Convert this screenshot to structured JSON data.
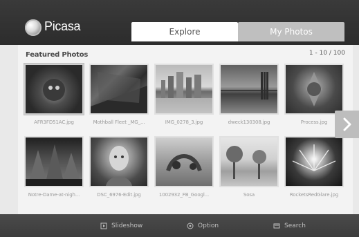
{
  "app": {
    "title": "Picasa",
    "tabs": [
      {
        "label": "Explore",
        "active": true
      },
      {
        "label": "My Photos",
        "active": false
      }
    ]
  },
  "main": {
    "section_title": "Featured Photos",
    "counter": "1 - 10 / 100",
    "photos": [
      {
        "filename": "AFR3FD51AC.jpg"
      },
      {
        "filename": "Mothball Fleet _MG_..."
      },
      {
        "filename": "IMG_0278_3.jpg"
      },
      {
        "filename": "dweck130308.jpg"
      },
      {
        "filename": "Process.jpg"
      },
      {
        "filename": "Notre-Dame-at-nigh..."
      },
      {
        "filename": "DSC_6976-Edit.jpg"
      },
      {
        "filename": "1002932_FB_Googl..."
      },
      {
        "filename": "Sosa"
      },
      {
        "filename": "RocketsRedGlare.jpg"
      }
    ]
  },
  "footer": {
    "items": [
      {
        "label": "Slideshow",
        "icon": "slideshow-icon"
      },
      {
        "label": "Option",
        "icon": "option-icon"
      },
      {
        "label": "Search",
        "icon": "search-icon"
      }
    ]
  },
  "colors": {
    "header_bg": "#2f2f2f",
    "active_tab_bg": "#ffffff",
    "inactive_tab_bg": "#bfbfbf",
    "footer_bg": "#3f3f3f"
  }
}
